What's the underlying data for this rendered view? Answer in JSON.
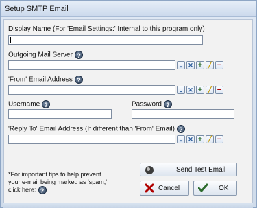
{
  "window": {
    "title": "Setup SMTP Email"
  },
  "display_name": {
    "label": "Display Name (For 'Email Settings:' Internal  to this program only)",
    "value": ""
  },
  "outgoing": {
    "label": "Outgoing Mail Server",
    "value": ""
  },
  "from": {
    "label": "'From' Email Address",
    "value": ""
  },
  "username": {
    "label": "Username",
    "value": ""
  },
  "password": {
    "label": "Password",
    "value": ""
  },
  "reply_to": {
    "label": "'Reply To' Email Address (If different than 'From' Email)",
    "value": ""
  },
  "help_glyph": "?",
  "icon_glyphs": {
    "dropdown": "⌄",
    "clear": "✕",
    "add": "+",
    "edit": "╱",
    "remove": "−"
  },
  "tips": {
    "line1": "*For important tips to help prevent",
    "line2": "your e-mail being marked as 'spam,'",
    "line3": "click here:"
  },
  "buttons": {
    "send_test": "Send Test Email",
    "cancel": "Cancel",
    "ok": "OK"
  },
  "colors": {
    "accent": "#2b5c9a",
    "danger": "#b00000",
    "success": "#2d6b2d"
  }
}
